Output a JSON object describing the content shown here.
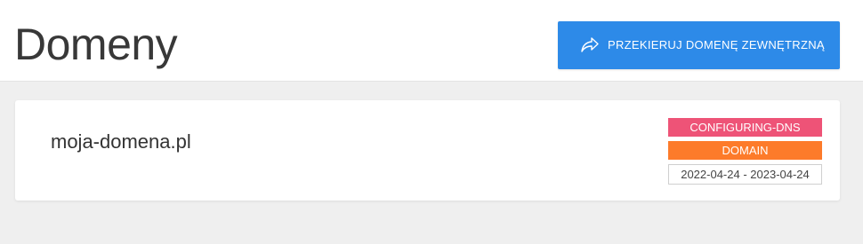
{
  "header": {
    "title": "Domeny",
    "redirect_button_label": "PRZEKIERUJ DOMENĘ ZEWNĘTRZNĄ",
    "redirect_button_icon": "share-arrow-icon"
  },
  "domains": [
    {
      "name": "moja-domena.pl",
      "status": "CONFIGURING-DNS",
      "type": "DOMAIN",
      "period": "2022-04-24 - 2023-04-24"
    }
  ],
  "colors": {
    "primary": "#2d8ae8",
    "status_badge": "#ee5377",
    "type_badge": "#fd7b2a",
    "background": "#efefef"
  }
}
